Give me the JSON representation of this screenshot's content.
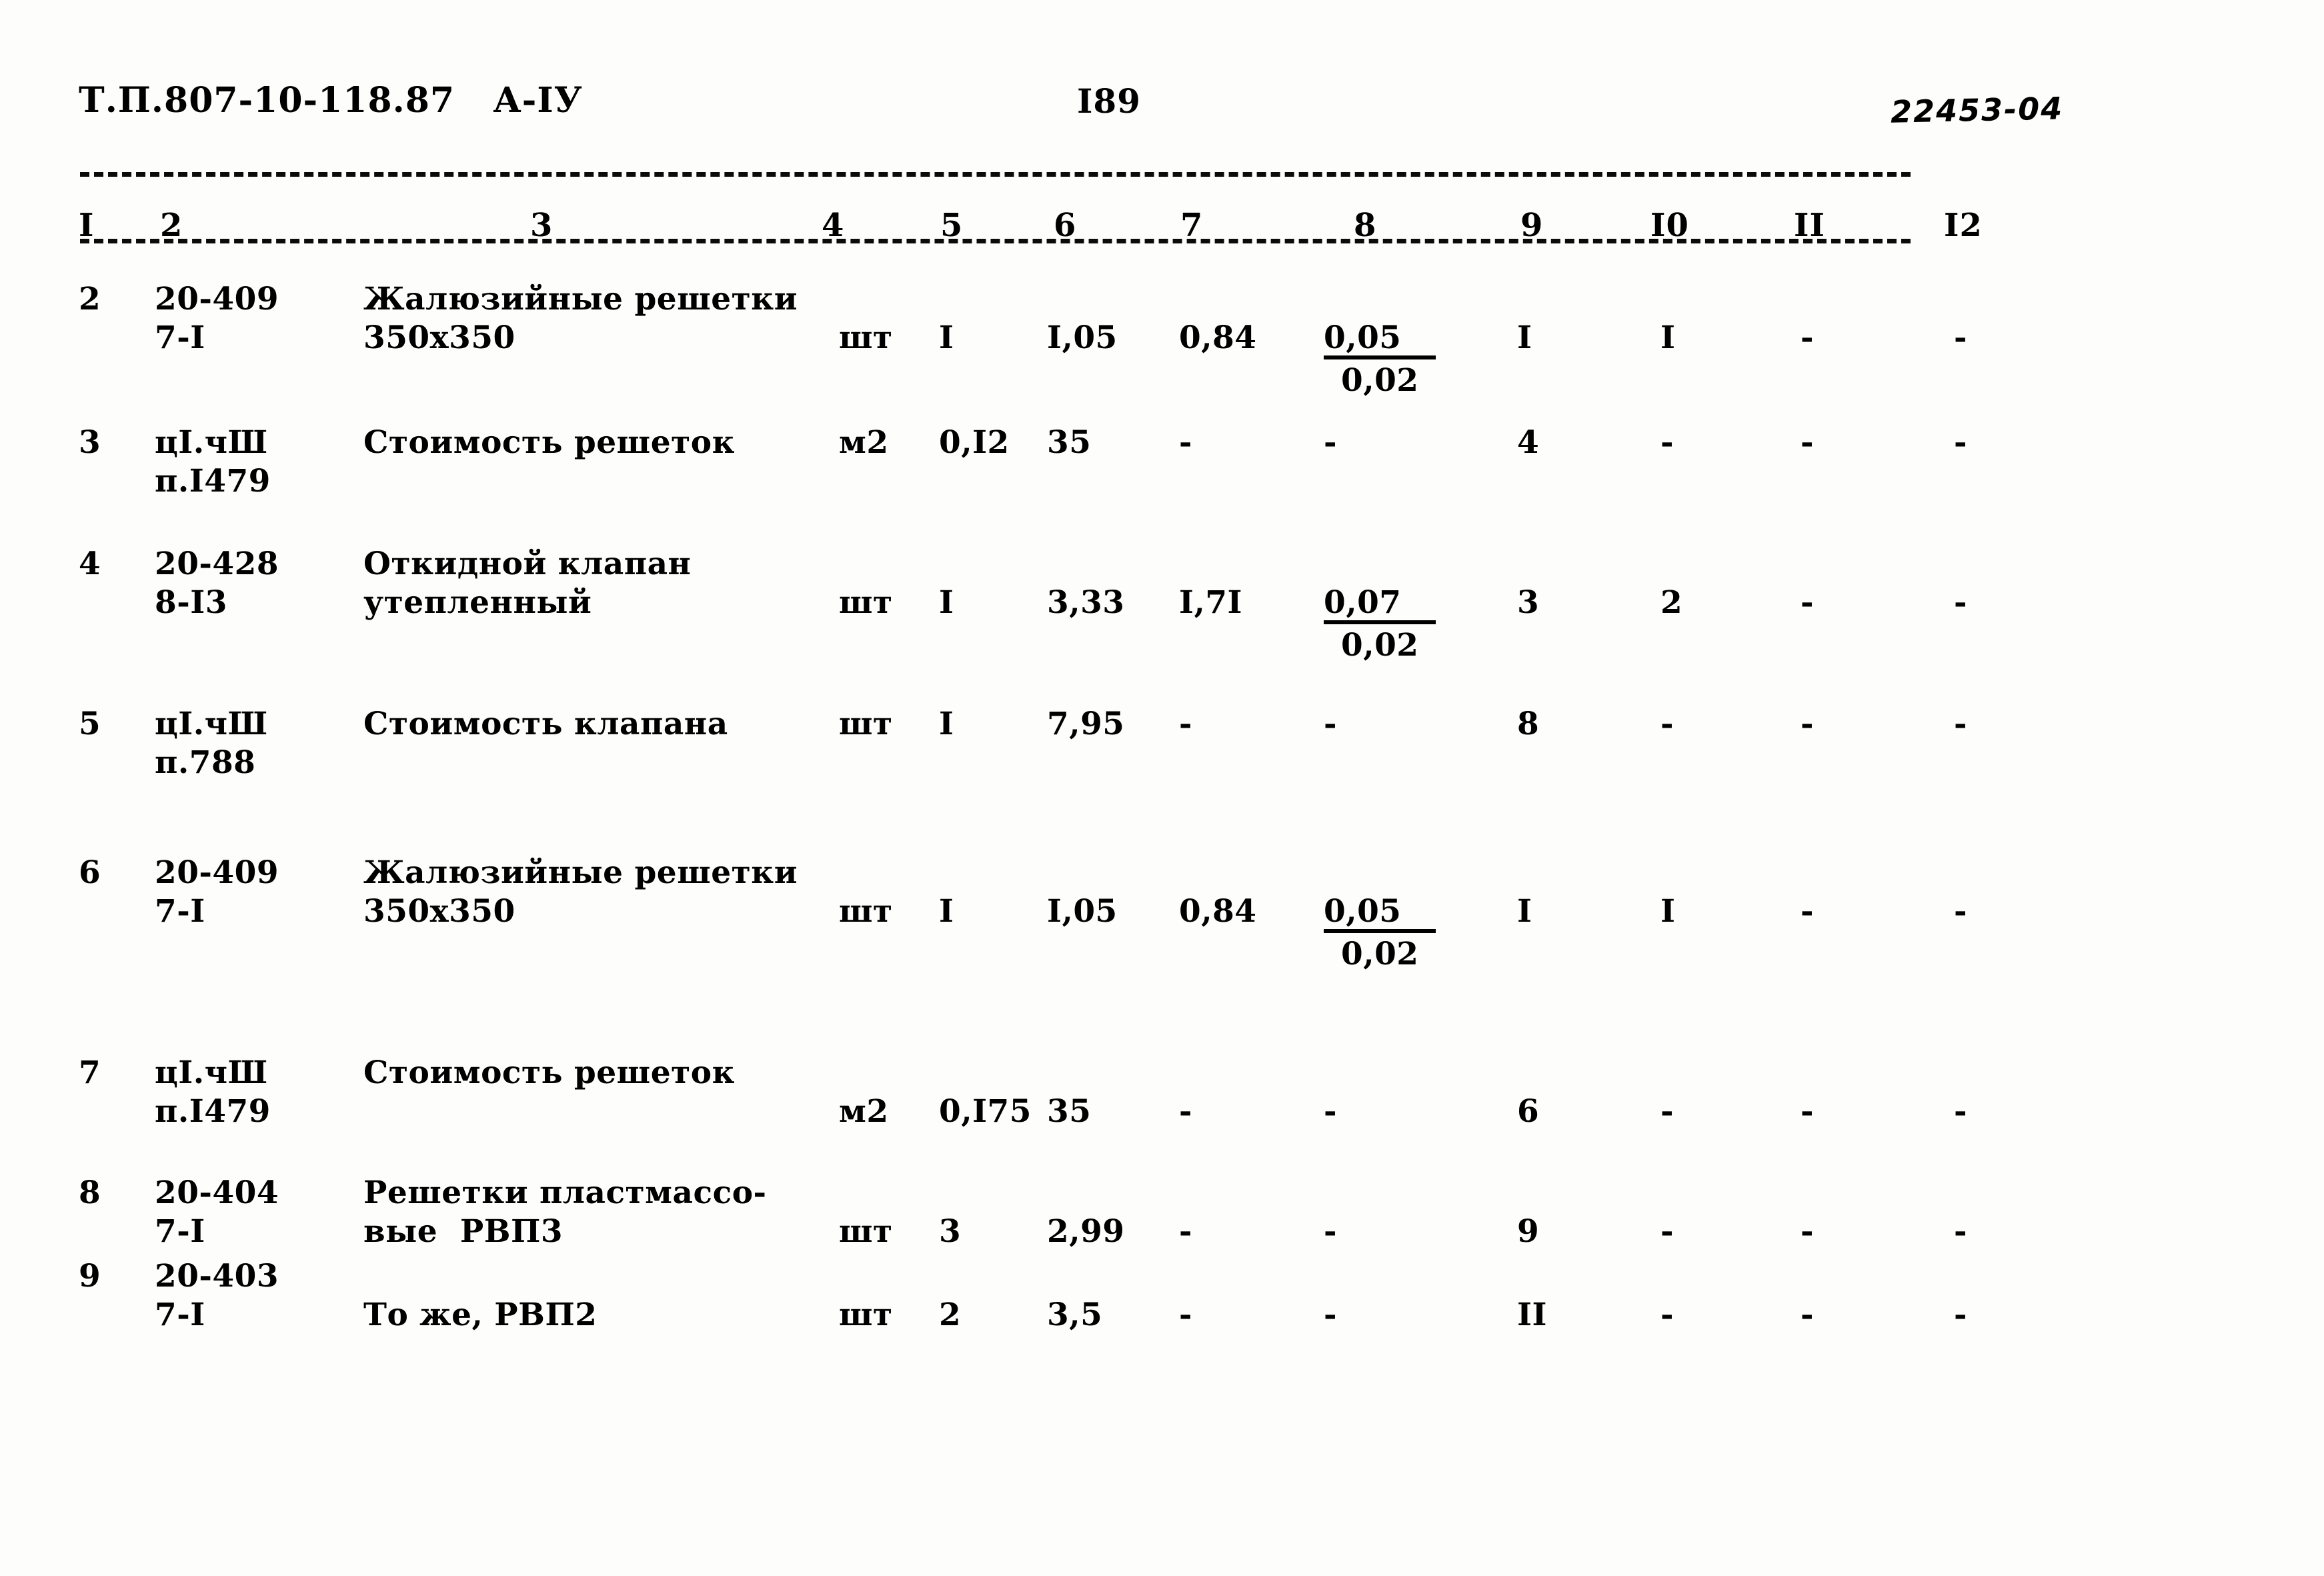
{
  "header": {
    "doc_code": "Т.П.807-10-118.87   А-IУ",
    "page_number": "I89",
    "archive_code": "22453-04"
  },
  "table": {
    "column_numbers": [
      "I",
      "2",
      "3",
      "4",
      "5",
      "6",
      "7",
      "8",
      "9",
      "I0",
      "II",
      "I2"
    ],
    "rows": [
      {
        "pos": "2",
        "code_line1": "20-409",
        "code_line2": "7-I",
        "name_line1": "Жалюзийные решетки",
        "name_line2": "350x350",
        "unit": "шт",
        "c5": "I",
        "c6": "I,05",
        "c7": "0,84",
        "c8_top": "0,05",
        "c8_bottom": "0,02",
        "c9": "I",
        "c10": "I",
        "c11": "-",
        "c12": "-"
      },
      {
        "pos": "3",
        "code_line1": "цI.чШ",
        "code_line2": "п.I479",
        "name_line1": "Стоимость решеток",
        "name_line2": "",
        "unit": "м2",
        "c5": "0,I2",
        "c6": "35",
        "c7": "-",
        "c8_top": "-",
        "c8_bottom": "",
        "c9": "4",
        "c10": "-",
        "c11": "-",
        "c12": "-"
      },
      {
        "pos": "4",
        "code_line1": "20-428",
        "code_line2": "8-I3",
        "name_line1": "Откидной клапан",
        "name_line2": "утепленный",
        "unit": "шт",
        "c5": "I",
        "c6": "3,33",
        "c7": "I,7I",
        "c8_top": "0,07",
        "c8_bottom": "0,02",
        "c9": "3",
        "c10": "2",
        "c11": "-",
        "c12": "-"
      },
      {
        "pos": "5",
        "code_line1": "цI.чШ",
        "code_line2": "п.788",
        "name_line1": "Стоимость клапана",
        "name_line2": "",
        "unit": "шт",
        "c5": "I",
        "c6": "7,95",
        "c7": "-",
        "c8_top": "-",
        "c8_bottom": "",
        "c9": "8",
        "c10": "-",
        "c11": "-",
        "c12": "-"
      },
      {
        "pos": "6",
        "code_line1": "20-409",
        "code_line2": "7-I",
        "name_line1": "Жалюзийные решетки",
        "name_line2": "350x350",
        "unit": "шт",
        "c5": "I",
        "c6": "I,05",
        "c7": "0,84",
        "c8_top": "0,05",
        "c8_bottom": "0,02",
        "c9": "I",
        "c10": "I",
        "c11": "-",
        "c12": "-"
      },
      {
        "pos": "7",
        "code_line1": "цI.чШ",
        "code_line2": "п.I479",
        "name_line1": "Стоимость решеток",
        "name_line2": "",
        "unit": "м2",
        "c5": "0,I75",
        "c6": "35",
        "c7": "-",
        "c8_top": "-",
        "c8_bottom": "",
        "c9": "6",
        "c10": "-",
        "c11": "-",
        "c12": "-"
      },
      {
        "pos": "8",
        "code_line1": "20-404",
        "code_line2": "7-I",
        "name_line1": "Решетки пластмассо-",
        "name_line2": "вые  РВП3",
        "unit": "шт",
        "c5": "3",
        "c6": "2,99",
        "c7": "-",
        "c8_top": "-",
        "c8_bottom": "",
        "c9": "9",
        "c10": "-",
        "c11": "-",
        "c12": "-"
      },
      {
        "pos": "9",
        "code_line1": "20-403",
        "code_line2": "7-I",
        "name_line1": "",
        "name_line2": "То же, РВП2",
        "unit": "шт",
        "c5": "2",
        "c6": "3,5",
        "c7": "-",
        "c8_top": "-",
        "c8_bottom": "",
        "c9": "II",
        "c10": "-",
        "c11": "-",
        "c12": "-"
      }
    ]
  }
}
